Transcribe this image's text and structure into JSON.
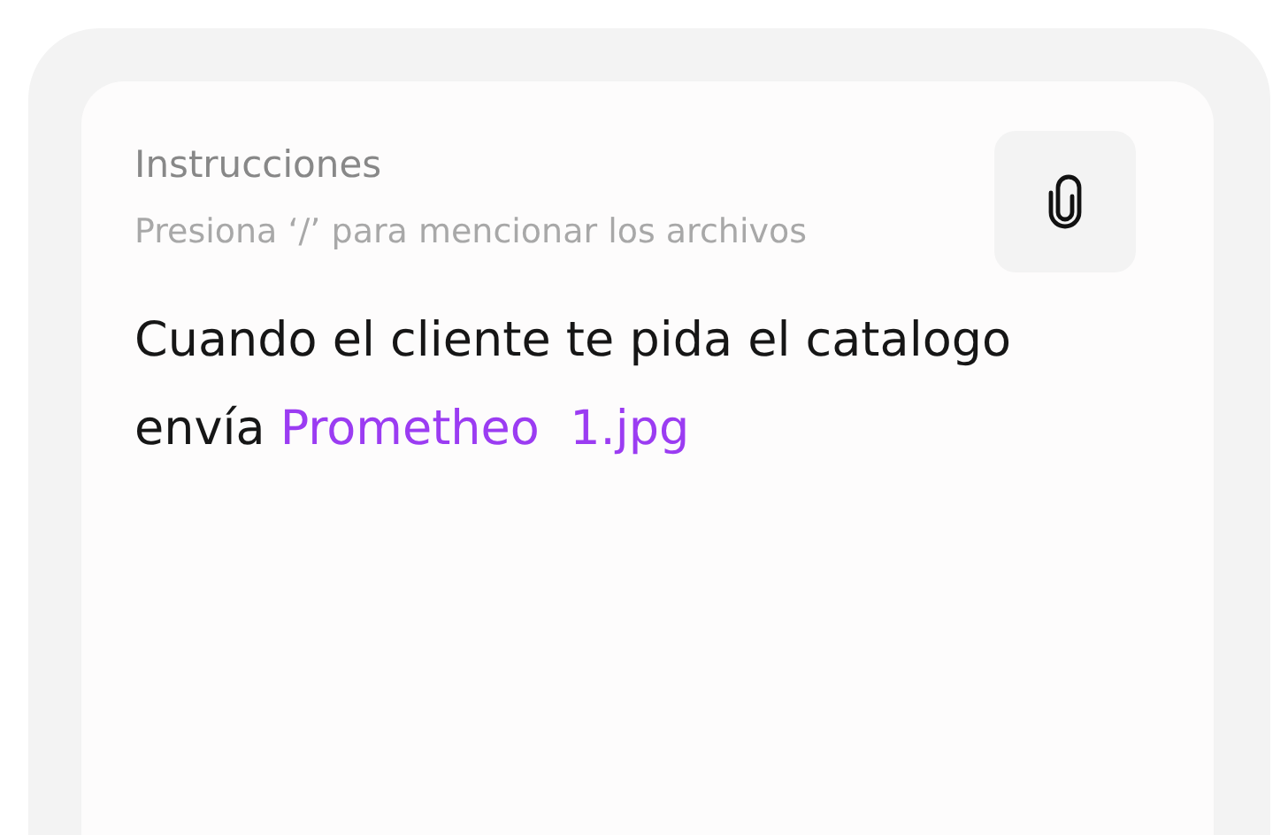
{
  "instructions": {
    "label": "Instrucciones",
    "hint": "Presiona ‘/’ para mencionar los archivos",
    "content": [
      {
        "kind": "text",
        "text": "Cuando el cliente te pida el catalogo envía "
      },
      {
        "kind": "mention",
        "text": "Prometheo  1.jpg"
      }
    ]
  }
}
